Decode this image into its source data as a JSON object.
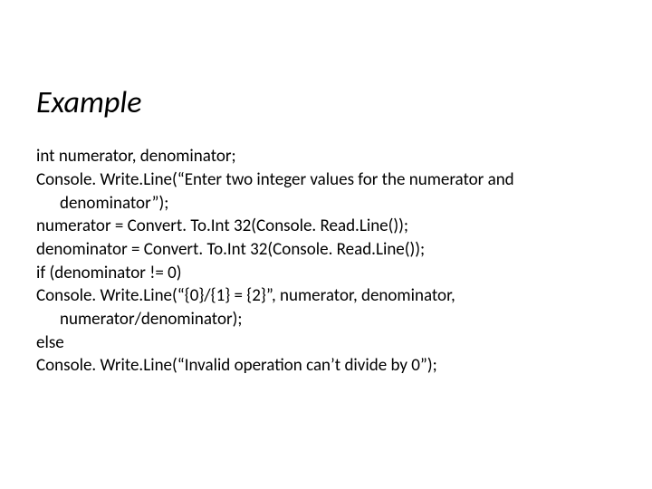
{
  "title": "Example",
  "code": {
    "l1": "int numerator, denominator;",
    "l2a": "Console. Write.Line(“Enter two integer values for the numerator and",
    "l2b": "denominator”);",
    "l3": "numerator = Convert. To.Int 32(Console. Read.Line());",
    "l4": "denominator = Convert. To.Int 32(Console. Read.Line());",
    "l5": "if (denominator != 0)",
    "l6a": "Console. Write.Line(“{0}/{1} = {2}”, numerator, denominator,",
    "l6b": "numerator/denominator);",
    "l7": "else",
    "l8": "Console. Write.Line(“Invalid operation can’t divide by 0”);"
  }
}
